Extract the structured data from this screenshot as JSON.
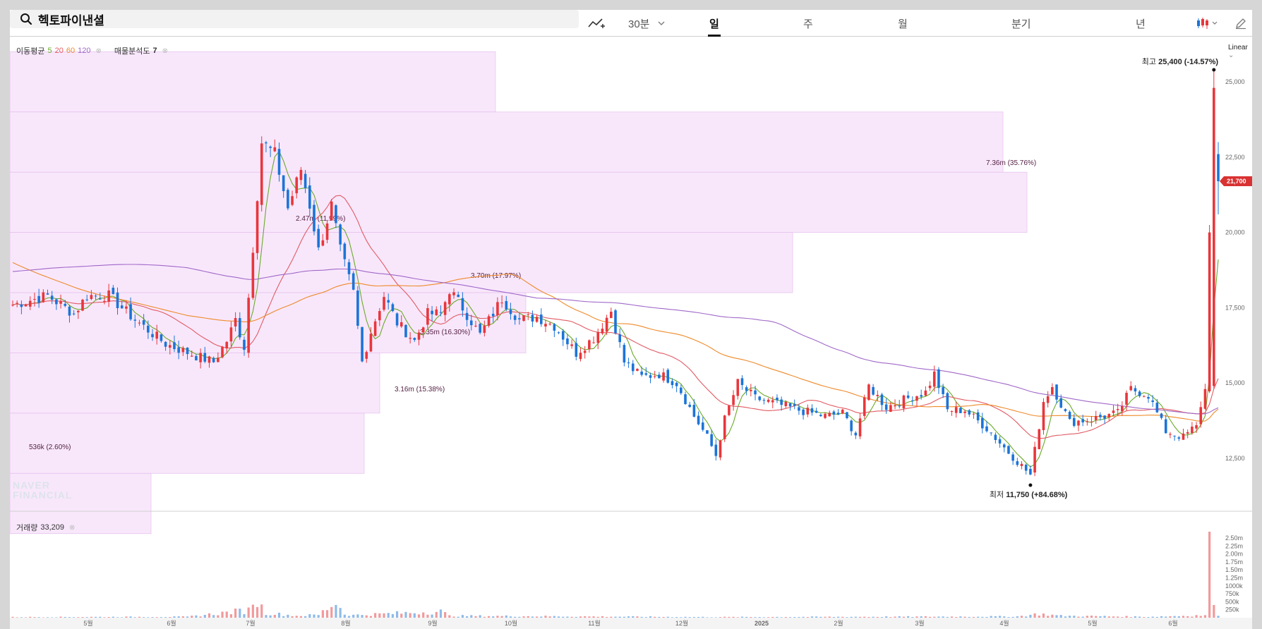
{
  "search": {
    "title": "헥토파이낸셜"
  },
  "toolbar": {
    "intervals": [
      "30분",
      "일",
      "주",
      "월",
      "분기",
      "년"
    ],
    "selected": "일"
  },
  "indicators": {
    "ma_label": "이동평균",
    "ma_periods": [
      "5",
      "20",
      "60",
      "120"
    ],
    "ma_colors": [
      "#6aaa2a",
      "#e15b64",
      "#ee8a2a",
      "#a068c8"
    ],
    "profile_label": "매물분석도",
    "profile_value": "7",
    "volume_label": "거래량",
    "volume_value": "33,209"
  },
  "scale_mode": "Linear",
  "watermark": [
    "NAVER",
    "FINANCIAL"
  ],
  "chart_data": {
    "type": "candlestick",
    "up_color": "#e8363c",
    "down_color": "#1b74d8",
    "ylim": [
      11000,
      26500
    ],
    "y_ticks": [
      "25,000",
      "22,500",
      "20,000",
      "17,500",
      "15,000",
      "12,500"
    ],
    "y_tick_values": [
      25000,
      22500,
      20000,
      17500,
      15000,
      12500
    ],
    "volume_ticks": [
      "2.50m",
      "2.25m",
      "2.00m",
      "1.75m",
      "1.50m",
      "1.25m",
      "1000k",
      "750k",
      "500k",
      "250k"
    ],
    "volume_tick_values": [
      2500000,
      2250000,
      2000000,
      1750000,
      1500000,
      1250000,
      1000000,
      750000,
      500000,
      250000
    ],
    "x_labels": [
      "5월",
      "6월",
      "7월",
      "8월",
      "9월",
      "10월",
      "11월",
      "12월",
      "2025",
      "2월",
      "3월",
      "4월",
      "5월",
      "6월"
    ],
    "current_price": "21,700",
    "current_price_value": 21700,
    "high_label": "최고",
    "high_value": "25,400",
    "high_change": "(-14.57%)",
    "low_label": "최저",
    "low_value": "11,750",
    "low_change": "(+84.68%)",
    "volume_profile": [
      {
        "low": 24000,
        "high": 26000,
        "value": "",
        "extent": 0.4
      },
      {
        "low": 22000,
        "high": 24000,
        "value": "7.36m (35.76%)",
        "extent": 0.817
      },
      {
        "low": 20000,
        "high": 22000,
        "value": "",
        "extent": 0.836
      },
      {
        "low": 18000,
        "high": 20000,
        "value": "2.47m (11.99%)",
        "extent": 0.644
      },
      {
        "low": 16000,
        "high": 18000,
        "value": "3.70m (17.97%)",
        "extent": 0.478
      },
      {
        "low": 14000,
        "high": 16000,
        "value": "3.35m (16.30%)",
        "extent": 0.298
      },
      {
        "low": 12000,
        "high": 14000,
        "value": "3.16m (15.38%)",
        "extent": 0.116
      },
      {
        "low": 10000,
        "high": 12000,
        "value": "536k (2.60%)",
        "extent": 0.0
      }
    ],
    "anchors": [
      [
        0,
        17600
      ],
      [
        8,
        17900
      ],
      [
        14,
        17300
      ],
      [
        17,
        17900
      ],
      [
        22,
        17900
      ],
      [
        28,
        17100
      ],
      [
        35,
        16300
      ],
      [
        42,
        15900
      ],
      [
        46,
        15700
      ],
      [
        49,
        16400
      ],
      [
        51,
        17100
      ],
      [
        53,
        16200
      ],
      [
        55,
        19500
      ],
      [
        57,
        23000
      ],
      [
        60,
        22600
      ],
      [
        63,
        20800
      ],
      [
        66,
        22100
      ],
      [
        68,
        20900
      ],
      [
        70,
        19400
      ],
      [
        73,
        20900
      ],
      [
        75,
        19400
      ],
      [
        78,
        18000
      ],
      [
        80,
        15700
      ],
      [
        82,
        16700
      ],
      [
        85,
        17900
      ],
      [
        88,
        17000
      ],
      [
        92,
        16400
      ],
      [
        95,
        17300
      ],
      [
        98,
        17300
      ],
      [
        100,
        18100
      ],
      [
        103,
        17500
      ],
      [
        107,
        16600
      ],
      [
        112,
        17800
      ],
      [
        116,
        17100
      ],
      [
        120,
        17200
      ],
      [
        124,
        16900
      ],
      [
        129,
        16000
      ],
      [
        133,
        16500
      ],
      [
        137,
        17400
      ],
      [
        140,
        15700
      ],
      [
        144,
        15200
      ],
      [
        148,
        15300
      ],
      [
        152,
        15000
      ],
      [
        156,
        13900
      ],
      [
        159,
        13200
      ],
      [
        161,
        12600
      ],
      [
        163,
        13800
      ],
      [
        166,
        15000
      ],
      [
        170,
        14500
      ],
      [
        175,
        14300
      ],
      [
        180,
        14100
      ],
      [
        186,
        13900
      ],
      [
        190,
        14000
      ],
      [
        193,
        13300
      ],
      [
        196,
        14900
      ],
      [
        200,
        14200
      ],
      [
        205,
        14500
      ],
      [
        209,
        14700
      ],
      [
        211,
        15300
      ],
      [
        214,
        14100
      ],
      [
        218,
        14100
      ],
      [
        223,
        13500
      ],
      [
        228,
        12700
      ],
      [
        233,
        11950
      ],
      [
        236,
        14400
      ],
      [
        238,
        14900
      ],
      [
        242,
        13700
      ],
      [
        247,
        13800
      ],
      [
        253,
        14000
      ],
      [
        256,
        14800
      ],
      [
        260,
        14600
      ],
      [
        264,
        13400
      ],
      [
        268,
        13200
      ],
      [
        271,
        13600
      ],
      [
        273,
        14800
      ],
      [
        275,
        25200
      ],
      [
        276,
        21700
      ]
    ],
    "vol_anchors": [
      [
        0,
        20000
      ],
      [
        40,
        30000
      ],
      [
        54,
        240000
      ],
      [
        55,
        600000
      ],
      [
        56,
        500000
      ],
      [
        58,
        150000
      ],
      [
        65,
        60000
      ],
      [
        70,
        90000
      ],
      [
        74,
        500000
      ],
      [
        76,
        120000
      ],
      [
        78,
        80000
      ],
      [
        98,
        200000
      ],
      [
        100,
        60000
      ],
      [
        160,
        20000
      ],
      [
        230,
        40000
      ],
      [
        235,
        120000
      ],
      [
        240,
        60000
      ],
      [
        260,
        30000
      ],
      [
        273,
        80000
      ],
      [
        274,
        2700000
      ],
      [
        275,
        400000
      ],
      [
        276,
        60000
      ]
    ]
  }
}
